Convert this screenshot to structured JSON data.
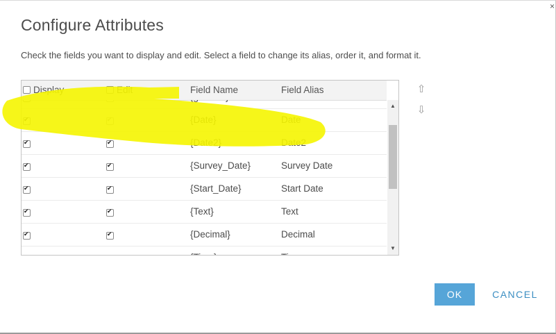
{
  "dialog": {
    "title": "Configure Attributes",
    "description": "Check the fields you want to display and edit. Select a field to change its alias, order it, and format it.",
    "close_glyph": "×"
  },
  "grid": {
    "columns": {
      "display": "Display",
      "edit": "Edit",
      "field_name": "Field Name",
      "field_alias": "Field Alias"
    },
    "rows": [
      {
        "field_name": "{globalid}",
        "field_alias": "GlobalID",
        "display": false,
        "edit": false,
        "edit_disabled": true
      },
      {
        "field_name": "{Date}",
        "field_alias": "Date",
        "display": true,
        "edit": true,
        "edit_disabled": true
      },
      {
        "field_name": "{Date2}",
        "field_alias": "Date2",
        "display": true,
        "edit": true,
        "edit_disabled": false
      },
      {
        "field_name": "{Survey_Date}",
        "field_alias": "Survey Date",
        "display": true,
        "edit": true,
        "edit_disabled": false
      },
      {
        "field_name": "{Start_Date}",
        "field_alias": "Start Date",
        "display": true,
        "edit": true,
        "edit_disabled": false
      },
      {
        "field_name": "{Text}",
        "field_alias": "Text",
        "display": true,
        "edit": true,
        "edit_disabled": false
      },
      {
        "field_name": "{Decimal}",
        "field_alias": "Decimal",
        "display": true,
        "edit": true,
        "edit_disabled": false
      },
      {
        "field_name": "{Time}",
        "field_alias": "Time",
        "display": true,
        "edit": true,
        "edit_disabled": false
      }
    ]
  },
  "buttons": {
    "ok": "OK",
    "cancel": "CANCEL"
  },
  "icons": {
    "move_up": "move-up-arrow-icon",
    "move_down": "move-down-arrow-icon",
    "scroll_up": "scroll-up-arrow-icon",
    "scroll_down": "scroll-down-arrow-icon"
  },
  "colors": {
    "primary_button": "#56a5d8",
    "cancel_text": "#3b8ec2",
    "highlight_marker": "#f5f500"
  }
}
